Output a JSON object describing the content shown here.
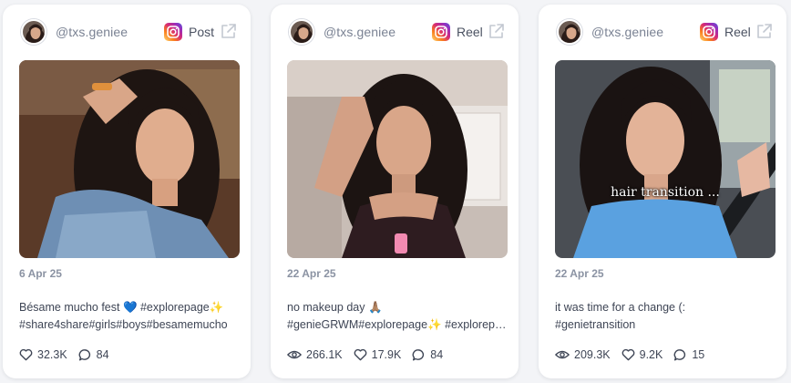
{
  "colors": {
    "background": "#f3f4f7",
    "card": "#ffffff",
    "muted_text": "#8b93a3",
    "body_text": "#3e4555",
    "instagram_gradient": [
      "#feda75",
      "#fa7e1e",
      "#d62976",
      "#962fbf",
      "#4f5bd5"
    ]
  },
  "cards": [
    {
      "username": "@txs.geniee",
      "platform_icon": "instagram-icon",
      "post_type": "Post",
      "open_icon": "external-link-icon",
      "date": "6 Apr 25",
      "caption_lines": [
        "Bésame mucho fest 💙 #explorepage✨",
        "#share4share#girls#boys#besamemucho"
      ],
      "stats": [
        {
          "icon": "heart-icon",
          "value": "32.3K"
        },
        {
          "icon": "comment-icon",
          "value": "84"
        }
      ]
    },
    {
      "username": "@txs.geniee",
      "platform_icon": "instagram-icon",
      "post_type": "Reel",
      "open_icon": "external-link-icon",
      "date": "22 Apr 25",
      "caption_lines": [
        "no makeup day 🙏🏽",
        "#genieGRWM#explorepage✨ #explorepage"
      ],
      "stats": [
        {
          "icon": "eye-icon",
          "value": "266.1K"
        },
        {
          "icon": "heart-icon",
          "value": "17.9K"
        },
        {
          "icon": "comment-icon",
          "value": "84"
        }
      ]
    },
    {
      "username": "@txs.geniee",
      "platform_icon": "instagram-icon",
      "post_type": "Reel",
      "open_icon": "external-link-icon",
      "media_overlay_text": "hair transition ...",
      "date": "22 Apr 25",
      "caption_lines": [
        "it was time for a change (:",
        "#genietransition"
      ],
      "stats": [
        {
          "icon": "eye-icon",
          "value": "209.3K"
        },
        {
          "icon": "heart-icon",
          "value": "9.2K"
        },
        {
          "icon": "comment-icon",
          "value": "15"
        }
      ]
    }
  ]
}
